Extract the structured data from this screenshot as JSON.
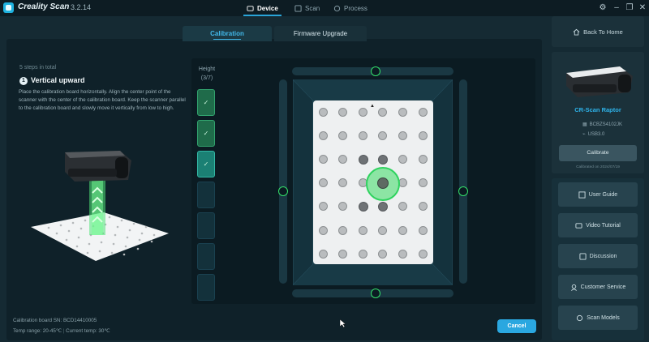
{
  "app": {
    "name": "Creality Scan",
    "version": "3.2.14"
  },
  "nav": {
    "tabs": [
      {
        "label": "Device"
      },
      {
        "label": "Scan"
      },
      {
        "label": "Process"
      }
    ]
  },
  "subtabs": {
    "calibration": "Calibration",
    "firmware": "Firmware Upgrade"
  },
  "step": {
    "total_text": "5 steps in total",
    "number": "1",
    "title": "Vertical upward",
    "description": "Place the calibration board horizontally. Align the center point of the scanner with the center of the calibration board. Keep the scanner parallel to the calibration board and slowly move it vertically from low to high."
  },
  "height": {
    "label": "Height",
    "progress": "(3/7)",
    "done_count": 3,
    "total": 7
  },
  "info": {
    "board_sn_label": "Calibration board SN:",
    "board_sn": "BCD14410005",
    "temp_range": "Temp range: 20-45℃",
    "current_temp": "Current temp: 30℃"
  },
  "actions": {
    "cancel": "Cancel"
  },
  "sidebar": {
    "back_home": "Back To Home",
    "device_name": "CR-Scan Raptor",
    "serial": "BCBZS4102JK",
    "connection": "USB3.0",
    "calibrate": "Calibrate",
    "calibrated_on": "Calibrated on 2024/07/19",
    "links": [
      {
        "label": "User Guide"
      },
      {
        "label": "Video Tutorial"
      },
      {
        "label": "Discussion"
      },
      {
        "label": "Customer Service"
      },
      {
        "label": "Scan Models"
      }
    ]
  },
  "colors": {
    "accent": "#2aa7e0",
    "progress": "#2fd35f",
    "background": "#152a33"
  }
}
